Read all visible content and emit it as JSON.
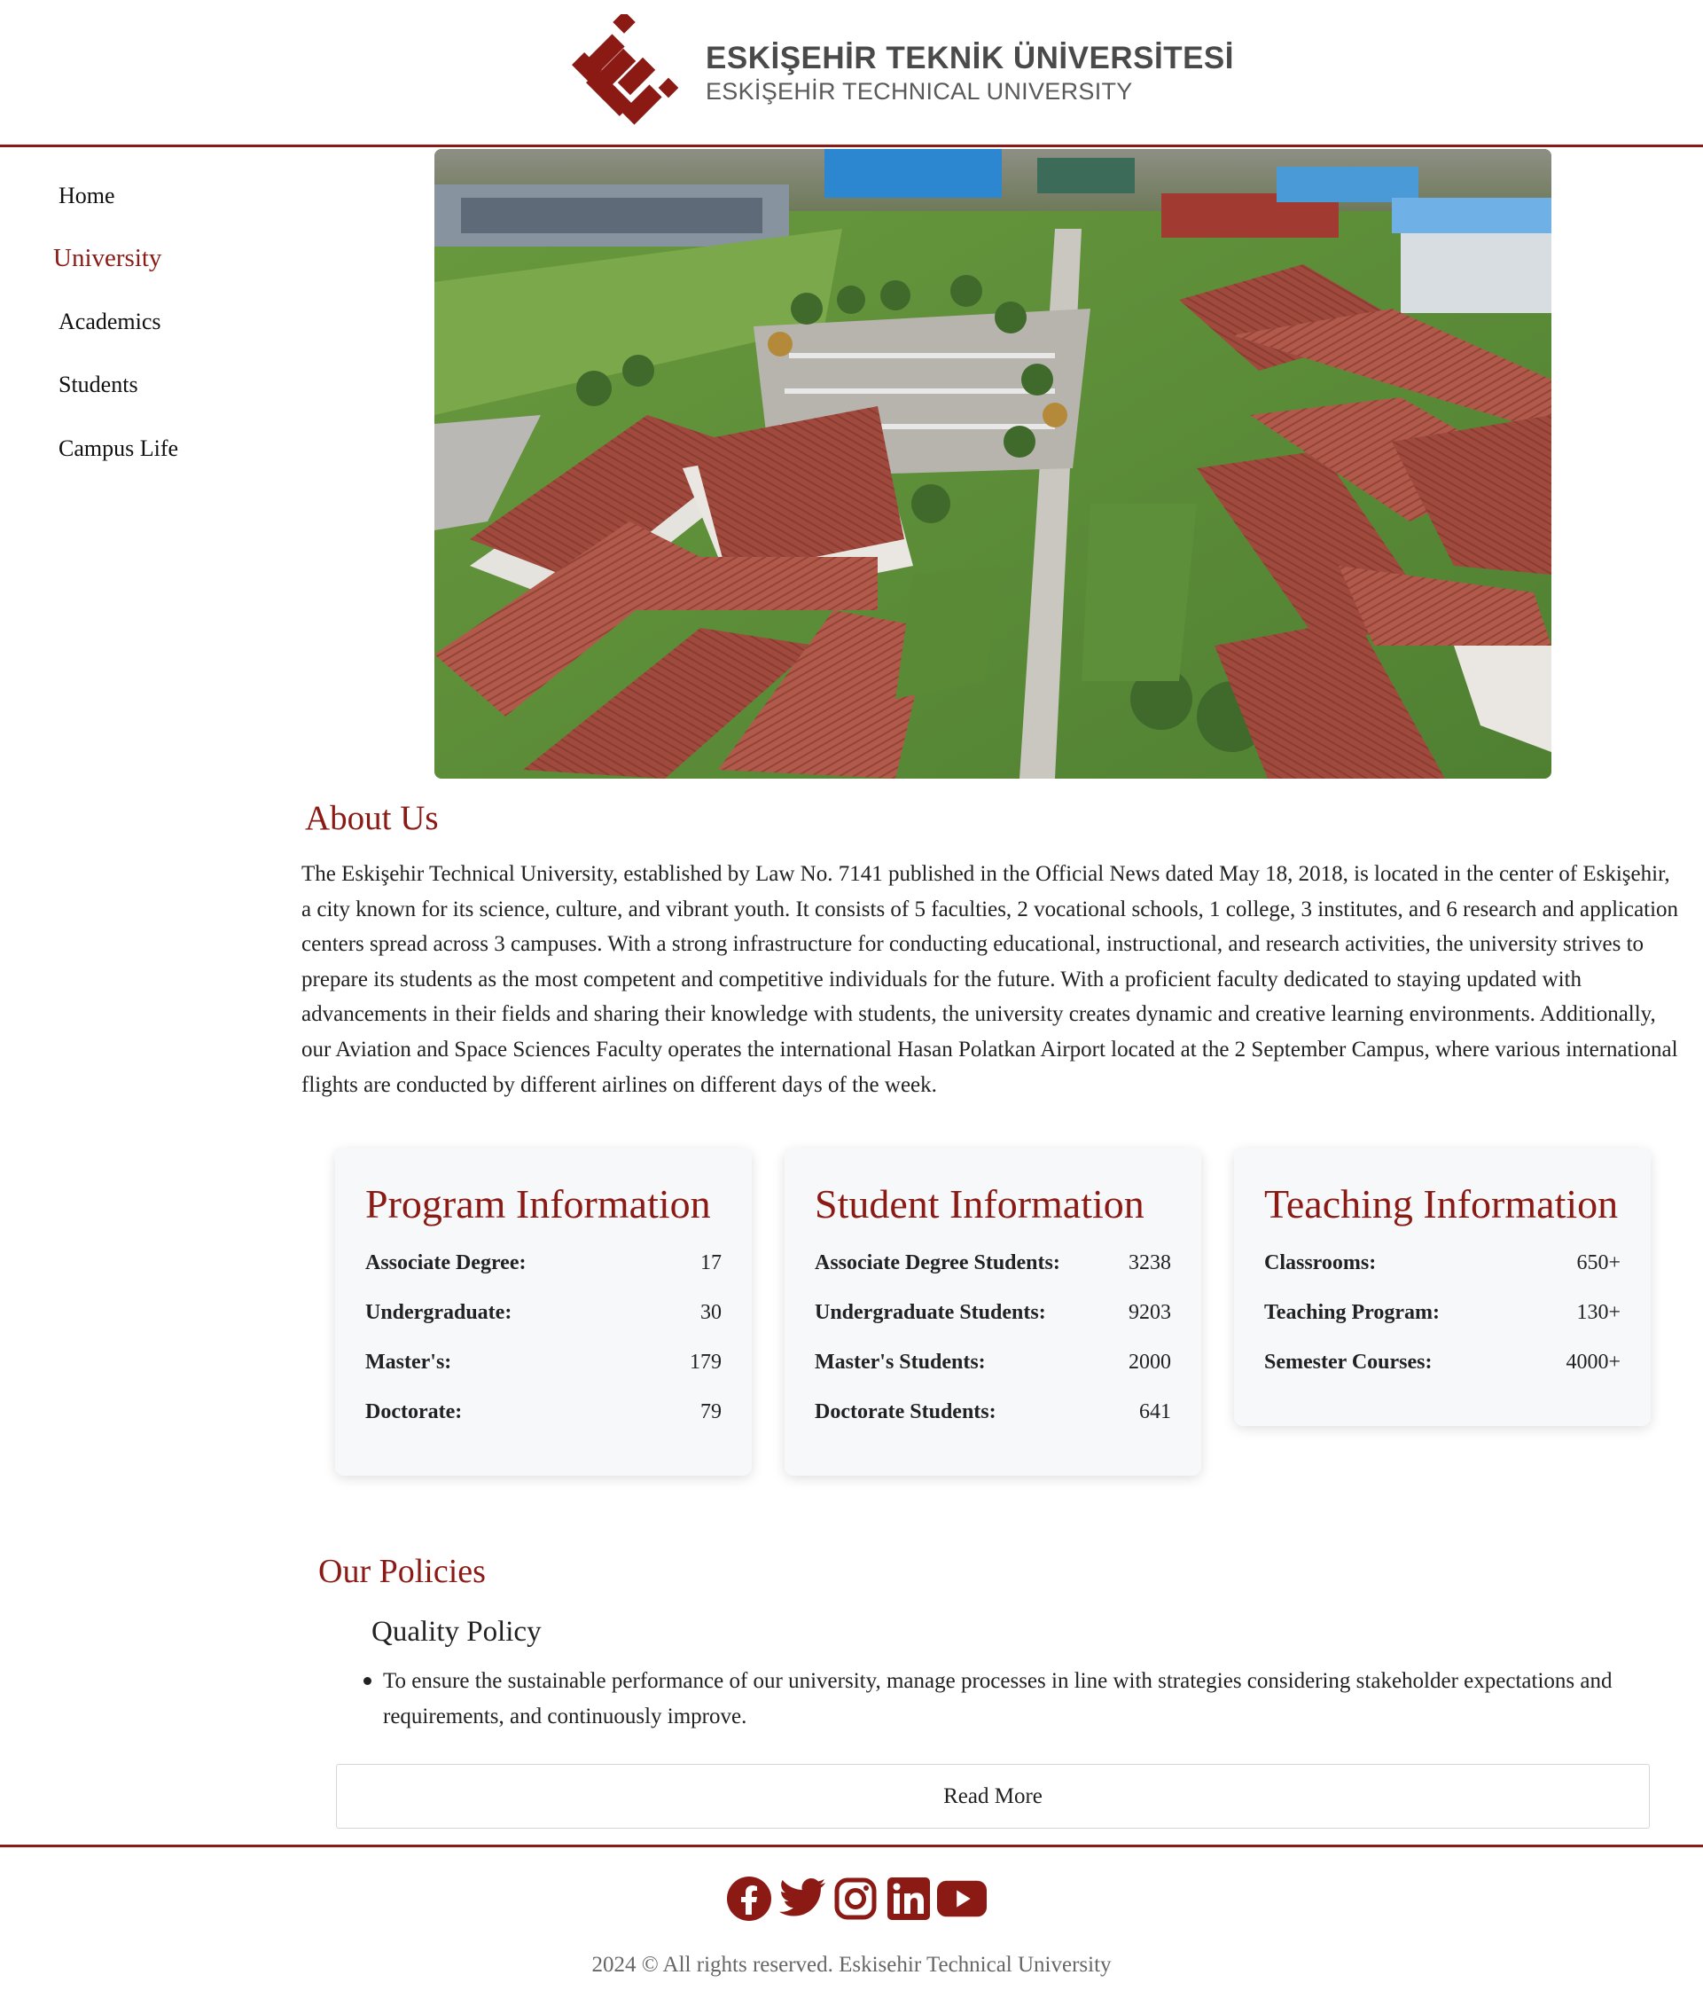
{
  "header": {
    "logo_name_tr": "ESKİŞEHİR TEKNİK ÜNİVERSİTESİ",
    "logo_name_en": "ESKİŞEHİR TECHNICAL UNIVERSITY",
    "brand_color": "#8b1a14"
  },
  "sidebar": {
    "items": [
      {
        "label": "Home"
      },
      {
        "label": "University",
        "active": true
      },
      {
        "label": "Academics"
      },
      {
        "label": "Students"
      },
      {
        "label": "Campus Life"
      }
    ]
  },
  "about": {
    "title": "About Us",
    "text": "The Eskişehir Technical University, established by Law No. 7141 published in the Official News dated May 18, 2018, is located in the center of Eskişehir, a city known for its science, culture, and vibrant youth. It consists of 5 faculties, 2 vocational schools, 1 college, 3 institutes, and 6 research and application centers spread across 3 campuses. With a strong infrastructure for conducting educational, instructional, and research activities, the university strives to prepare its students as the most competent and competitive individuals for the future. With a proficient faculty dedicated to staying updated with advancements in their fields and sharing their knowledge with students, the university creates dynamic and creative learning environments. Additionally, our Aviation and Space Sciences Faculty operates the international Hasan Polatkan Airport located at the 2 September Campus, where various international flights are conducted by different airlines on different days of the week."
  },
  "cards": [
    {
      "title": "Program Information",
      "rows": [
        {
          "label": "Associate Degree:",
          "value": "17"
        },
        {
          "label": "Undergraduate:",
          "value": "30"
        },
        {
          "label": "Master's:",
          "value": "179"
        },
        {
          "label": "Doctorate:",
          "value": "79"
        }
      ]
    },
    {
      "title": "Student Information",
      "rows": [
        {
          "label": "Associate Degree Students:",
          "value": "3238"
        },
        {
          "label": "Undergraduate Students:",
          "value": "9203"
        },
        {
          "label": "Master's Students:",
          "value": "2000"
        },
        {
          "label": "Doctorate Students:",
          "value": "641"
        }
      ]
    },
    {
      "title": "Teaching Information",
      "rows": [
        {
          "label": "Classrooms:",
          "value": "650+"
        },
        {
          "label": "Teaching Program:",
          "value": "130+"
        },
        {
          "label": "Semester Courses:",
          "value": "4000+"
        }
      ]
    }
  ],
  "policies": {
    "title": "Our Policies",
    "subtitle": "Quality Policy",
    "items": [
      "To ensure the sustainable performance of our university, manage processes in line with strategies considering stakeholder expectations and requirements, and continuously improve."
    ],
    "read_more": "Read More"
  },
  "footer": {
    "socials": [
      "facebook-icon",
      "twitter-icon",
      "instagram-icon",
      "linkedin-icon",
      "youtube-icon"
    ],
    "copyright": "2024 © All rights reserved. Eskisehir Technical University"
  }
}
